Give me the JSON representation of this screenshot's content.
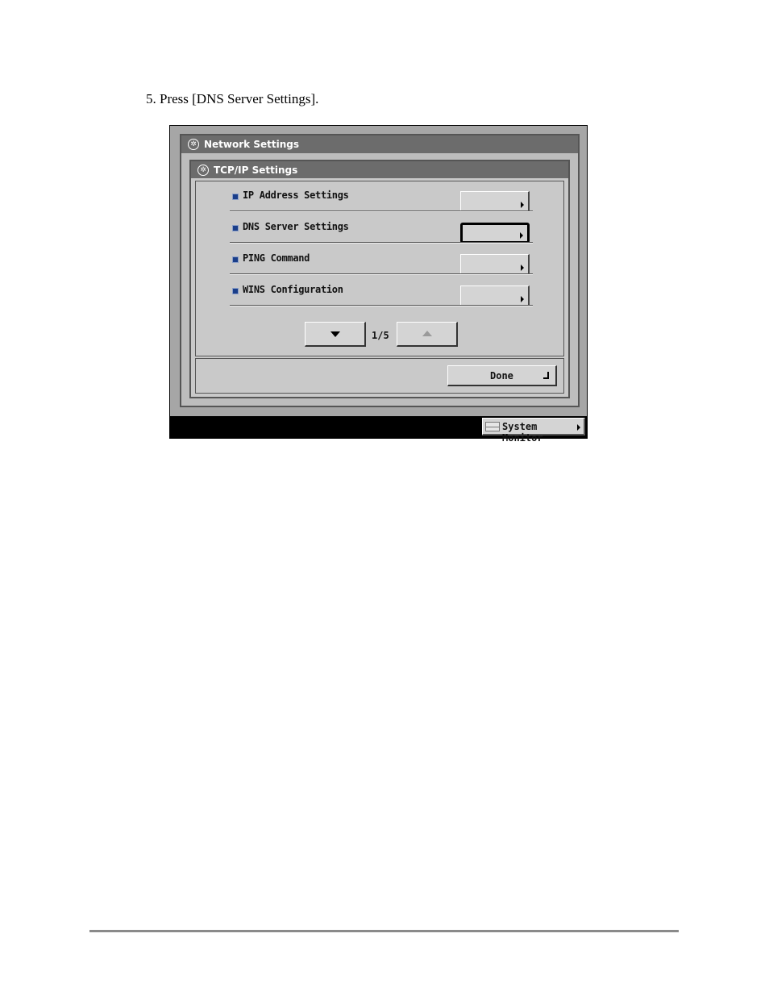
{
  "instruction": "5.  Press [DNS Server Settings].",
  "screen": {
    "outer_title": "Network Settings",
    "inner_title": "TCP/IP Settings",
    "menu_items": [
      {
        "label": "IP Address Settings",
        "selected": false
      },
      {
        "label": "DNS Server Settings",
        "selected": true
      },
      {
        "label": "PING Command",
        "selected": false
      },
      {
        "label": "WINS Configuration",
        "selected": false
      }
    ],
    "page_indicator": "1/5",
    "done_label": "Done",
    "system_monitor_label": "System Monitor",
    "colors": {
      "bullet": "#1a3e8a",
      "titlebar": "#6c6c6c",
      "panel": "#c9c9c9"
    }
  }
}
